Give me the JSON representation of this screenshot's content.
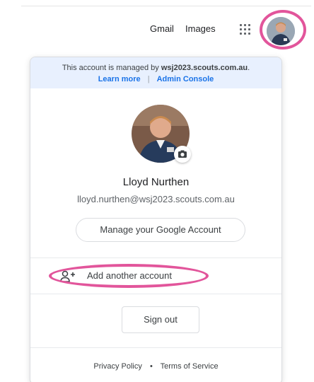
{
  "topbar": {
    "gmail": "Gmail",
    "images": "Images",
    "apps_icon": "apps-grid-icon"
  },
  "account_card": {
    "managed_prefix": "This account is managed by",
    "managed_domain": "wsj2023.scouts.com.au",
    "managed_suffix": ".",
    "learn_more": "Learn more",
    "separator": "|",
    "admin_console": "Admin Console",
    "name": "Lloyd Nurthen",
    "email": "lloyd.nurthen@wsj2023.scouts.com.au",
    "manage_account": "Manage your Google Account",
    "add_account": "Add another account",
    "sign_out": "Sign out",
    "privacy_policy": "Privacy Policy",
    "footer_separator": "•",
    "terms": "Terms of Service"
  },
  "colors": {
    "highlight": "#e2559b",
    "link": "#1a73e8",
    "managed_bg": "#e8f0fe"
  }
}
